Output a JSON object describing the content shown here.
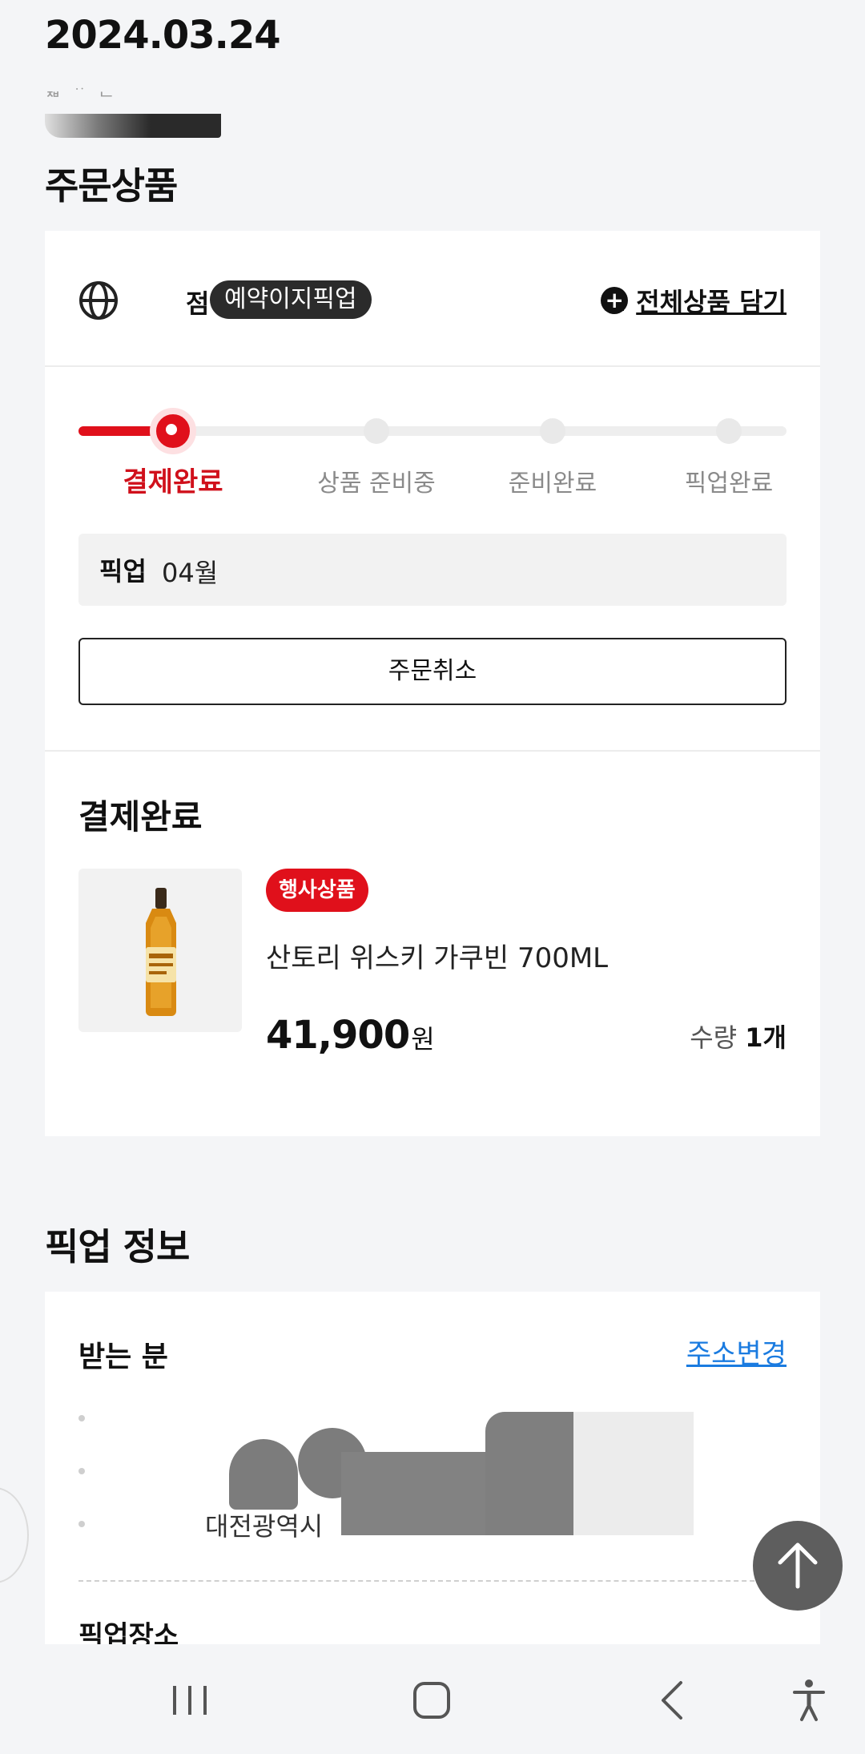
{
  "header": {
    "date": "2024.03.24"
  },
  "order_items": {
    "title": "주문상품",
    "store_fragment": "점",
    "pickup_type_badge": "예약이지픽업",
    "add_all_label": "전체상품 담기",
    "steps": [
      {
        "label": "결제완료",
        "active": true
      },
      {
        "label": "상품 준비중",
        "active": false
      },
      {
        "label": "준비완료",
        "active": false
      },
      {
        "label": "픽업완료",
        "active": false
      }
    ],
    "pickup": {
      "label": "픽업",
      "value": "04월"
    },
    "cancel_label": "주문취소",
    "status_title": "결제완료",
    "product": {
      "badge": "행사상품",
      "name": "산토리 위스키 가쿠빈 700ML",
      "price": "41,900",
      "price_unit": "원",
      "qty_label": "수량",
      "qty_value": "1개"
    }
  },
  "pickup_info": {
    "title": "픽업 정보",
    "recipient_label": "받는 분",
    "address_change_label": "주소변경",
    "city": "대전광역시",
    "pickup_place_label": "픽업장소"
  },
  "colors": {
    "accent_red": "#e0101b",
    "link_blue": "#1a7be0"
  },
  "icons": {
    "store_logo": "globe-logo",
    "add_all": "plus-circle-icon",
    "scroll_top": "arrow-up-icon",
    "nav": [
      "recent-apps-icon",
      "home-icon",
      "back-icon",
      "accessibility-icon"
    ]
  }
}
